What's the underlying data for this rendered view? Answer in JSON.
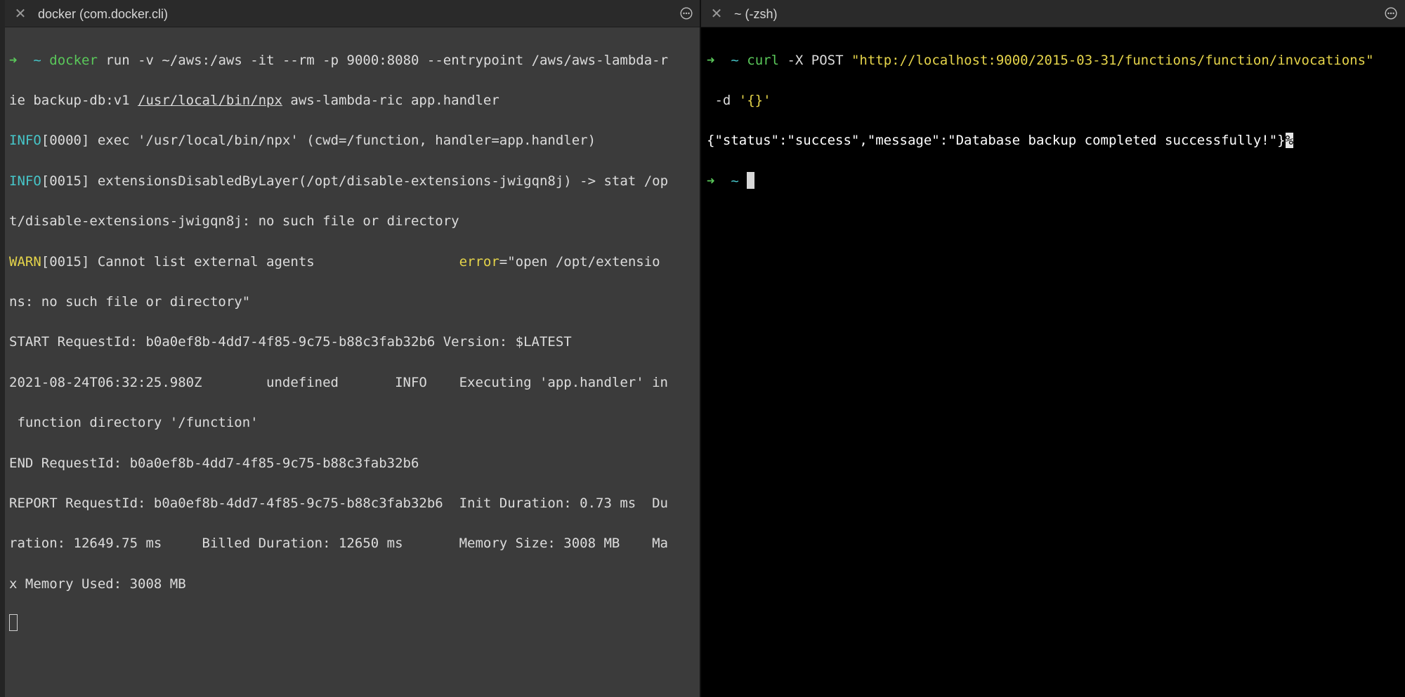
{
  "left_pane": {
    "tab_title": "docker (com.docker.cli)",
    "prompt_arrow": "➜",
    "prompt_dir": "~",
    "cmd_name": "docker",
    "cmd_part1": " run -v ~/aws:/aws -it --rm -p 9000:8080 --entrypoint /aws/aws-lambda-r",
    "cmd_line2_pre": "ie backup-db:v1 ",
    "cmd_line2_path": "/usr/local/bin/npx",
    "cmd_line2_post": " aws-lambda-ric app.handler",
    "log1_level": "INFO",
    "log1_text": "[0000] exec '/usr/local/bin/npx' (cwd=/function, handler=app.handler)",
    "log2_level": "INFO",
    "log2_text": "[0015] extensionsDisabledByLayer(/opt/disable-extensions-jwigqn8j) -> stat /op",
    "log2_cont": "t/disable-extensions-jwigqn8j: no such file or directory",
    "log3_level": "WARN",
    "log3_text": "[0015] Cannot list external agents                  ",
    "log3_err_key": "error",
    "log3_err_val": "=\"open /opt/extensio",
    "log3_cont": "ns: no such file or directory\"",
    "start_line": "START RequestId: b0a0ef8b-4dd7-4f85-9c75-b88c3fab32b6 Version: $LATEST",
    "exec_line1": "2021-08-24T06:32:25.980Z        undefined       INFO    Executing 'app.handler' in",
    "exec_line2": " function directory '/function'",
    "end_line": "END RequestId: b0a0ef8b-4dd7-4f85-9c75-b88c3fab32b6",
    "report_line1": "REPORT RequestId: b0a0ef8b-4dd7-4f85-9c75-b88c3fab32b6  Init Duration: 0.73 ms  Du",
    "report_line2": "ration: 12649.75 ms     Billed Duration: 12650 ms       Memory Size: 3008 MB    Ma",
    "report_line3": "x Memory Used: 3008 MB"
  },
  "right_pane": {
    "tab_title": "~ (-zsh)",
    "prompt_arrow": "➜",
    "prompt_dir": "~",
    "cmd_name": "curl",
    "cmd_opts": " -X POST ",
    "cmd_url": "\"http://localhost:9000/2015-03-31/functions/function/invocations\"",
    "cmd_line2_opt": " -d ",
    "cmd_line2_data": "'{}'",
    "response": "{\"status\":\"success\",\"message\":\"Database backup completed successfully!\"}",
    "no_newline_marker": "%"
  },
  "colors": {
    "prompt_green": "#5ac85a",
    "log_cyan": "#46c6c9",
    "string_yellow": "#e5d44a",
    "left_bg": "#3b3b3b",
    "right_bg": "#000000"
  },
  "icons": {
    "close": "close-icon",
    "menu": "more-options-icon"
  }
}
